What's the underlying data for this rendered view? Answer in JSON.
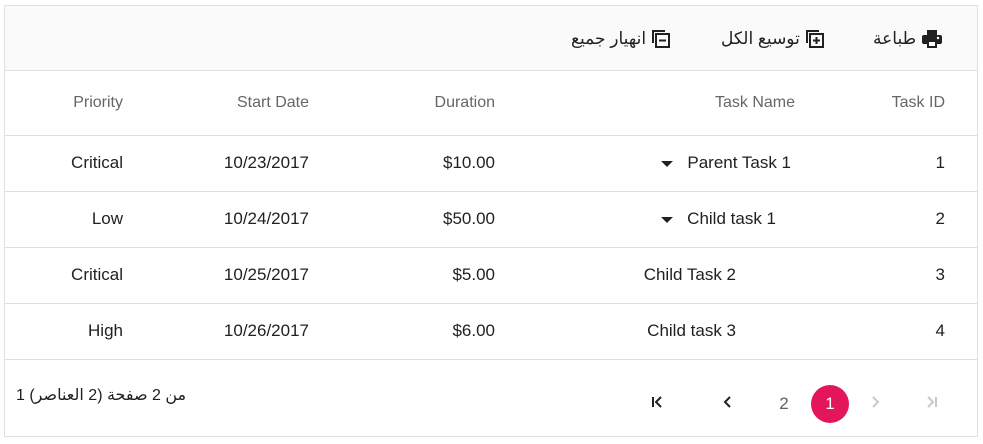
{
  "toolbar": {
    "print_label": "طباعة",
    "expand_all_label": "توسيع الكل",
    "collapse_all_label": "انهيار جميع"
  },
  "columns": {
    "task_id": "Task ID",
    "task_name": "Task Name",
    "duration": "Duration",
    "start_date": "Start Date",
    "priority": "Priority"
  },
  "rows": [
    {
      "task_id": "1",
      "task_name": "Parent Task 1",
      "duration": "$10.00",
      "start_date": "10/23/2017",
      "priority": "Critical",
      "expandable": true
    },
    {
      "task_id": "2",
      "task_name": "Child task 1",
      "duration": "$50.00",
      "start_date": "10/24/2017",
      "priority": "Low",
      "expandable": true
    },
    {
      "task_id": "3",
      "task_name": "Child Task 2",
      "duration": "$5.00",
      "start_date": "10/25/2017",
      "priority": "Critical",
      "expandable": false
    },
    {
      "task_id": "4",
      "task_name": "Child task 3",
      "duration": "$6.00",
      "start_date": "10/26/2017",
      "priority": "High",
      "expandable": false
    }
  ],
  "pager": {
    "info": "1 من 2 صفحة (2 العناصر)",
    "pages": [
      "1",
      "2"
    ],
    "current_page": "1"
  },
  "colors": {
    "accent": "#e3165b",
    "border": "#e0e0e0",
    "header_text": "#666666",
    "toolbar_bg": "#fafafa"
  },
  "icons": [
    "print-icon",
    "expand-all-icon",
    "collapse-all-icon",
    "chevron-down-icon",
    "first-page-icon",
    "prev-page-icon",
    "next-page-icon",
    "last-page-icon"
  ]
}
